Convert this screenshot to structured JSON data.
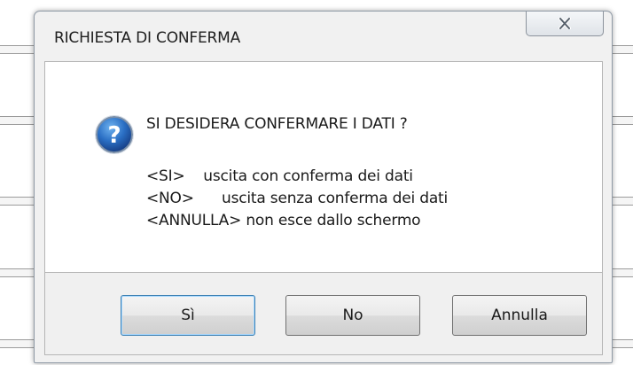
{
  "dialog": {
    "title": "RICHIESTA DI CONFERMA",
    "close_icon": "close-icon",
    "message_icon": "question-icon",
    "icon_color": "#1f5ca8",
    "heading": "SI DESIDERA CONFERMARE I DATI ?",
    "lines": [
      "<SI>    uscita con conferma dei dati",
      "<NO>      uscita senza conferma dei dati",
      "<ANNULLA> non esce dallo schermo"
    ],
    "buttons": {
      "yes": "Sì",
      "no": "No",
      "cancel": "Annulla"
    }
  }
}
